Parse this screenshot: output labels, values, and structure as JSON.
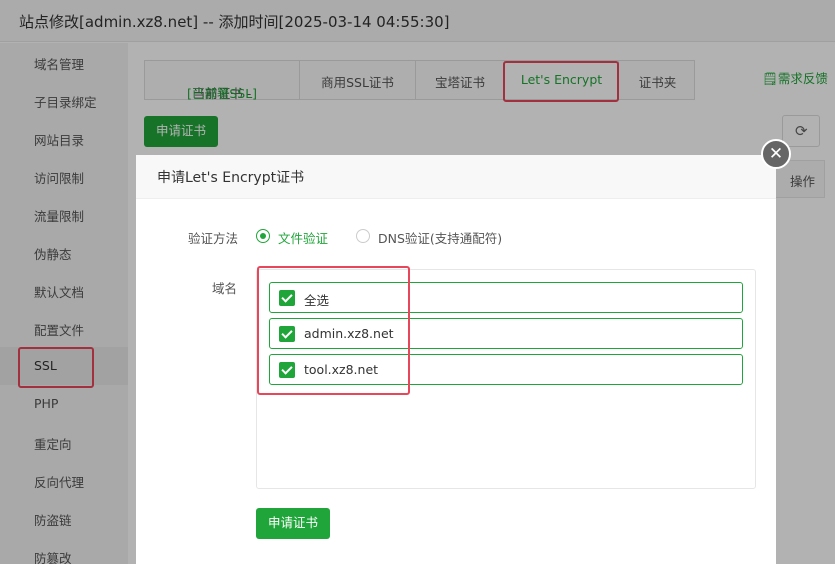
{
  "window": {
    "title": "站点修改[admin.xz8.net] -- 添加时间[2025-03-14 04:55:30]"
  },
  "sidebar": {
    "items": [
      {
        "label": "域名管理"
      },
      {
        "label": "子目录绑定"
      },
      {
        "label": "网站目录"
      },
      {
        "label": "访问限制"
      },
      {
        "label": "流量限制"
      },
      {
        "label": "伪静态"
      },
      {
        "label": "默认文档"
      },
      {
        "label": "配置文件"
      },
      {
        "label": "SSL"
      },
      {
        "label": "PHP"
      },
      {
        "label": "重定向"
      },
      {
        "label": "反向代理"
      },
      {
        "label": "防盗链"
      },
      {
        "label": "防篡改"
      }
    ],
    "active": "SSL"
  },
  "tabs": {
    "current_prefix": "当前证书 -",
    "current_status": "[已部署SSL]",
    "commercial": "商用SSL证书",
    "baota": "宝塔证书",
    "letsencrypt": "Let's Encrypt",
    "folder": "证书夹",
    "active": "Let's Encrypt"
  },
  "feedback": {
    "label": "需求反馈"
  },
  "background": {
    "apply_button": "申请证书",
    "table_ops_header": "操作"
  },
  "modal": {
    "title": "申请Let's Encrypt证书",
    "verify_label": "验证方法",
    "verify_options": [
      {
        "label": "文件验证",
        "selected": true
      },
      {
        "label": "DNS验证(支持通配符)",
        "selected": false
      }
    ],
    "domain_label": "域名",
    "domains": [
      {
        "label": "全选",
        "checked": true
      },
      {
        "label": "admin.xz8.net",
        "checked": true
      },
      {
        "label": "tool.xz8.net",
        "checked": true
      }
    ],
    "submit_label": "申请证书"
  },
  "colors": {
    "accent": "#20a53a",
    "highlight": "#e8465a"
  }
}
